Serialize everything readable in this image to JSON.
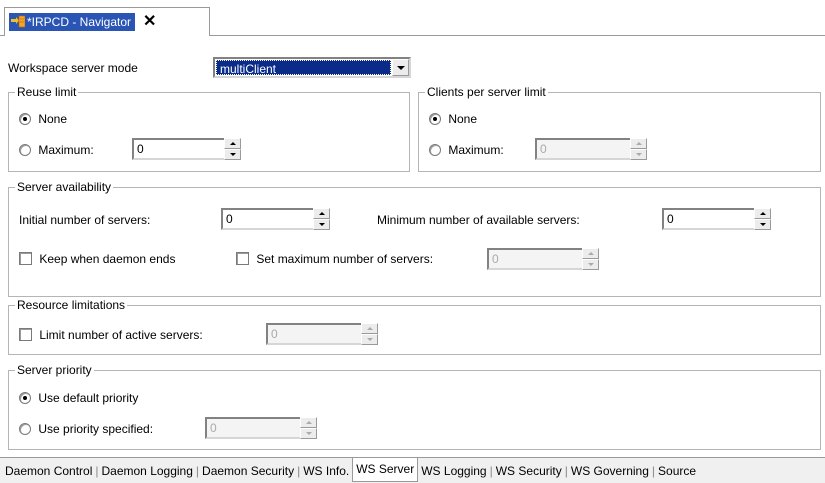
{
  "editor_tab": {
    "title": "*IRPCD - Navigator",
    "close_label": "✕"
  },
  "workspace": {
    "label": "Workspace server mode",
    "value": "multiClient"
  },
  "reuse_limit": {
    "legend": "Reuse limit",
    "none_label": "None",
    "maximum_label": "Maximum:",
    "maximum_value": "0"
  },
  "clients_per_server": {
    "legend": "Clients per server limit",
    "none_label": "None",
    "maximum_label": "Maximum:",
    "maximum_value": "0"
  },
  "server_availability": {
    "legend": "Server availability",
    "initial_label": "Initial number of servers:",
    "initial_value": "0",
    "minimum_label": "Minimum number of available servers:",
    "minimum_value": "0",
    "keep_label": "Keep when daemon ends",
    "setmax_label": "Set maximum number of servers:",
    "setmax_value": "0"
  },
  "resource_limitations": {
    "legend": "Resource limitations",
    "limit_label": "Limit number of active servers:",
    "limit_value": "0"
  },
  "server_priority": {
    "legend": "Server priority",
    "default_label": "Use default priority",
    "specified_label": "Use priority specified:",
    "specified_value": "0"
  },
  "bottom_tabs": [
    "Daemon Control",
    "Daemon Logging",
    "Daemon Security",
    "WS Info.",
    "WS Server",
    "WS Logging",
    "WS Security",
    "WS Governing",
    "Source"
  ]
}
